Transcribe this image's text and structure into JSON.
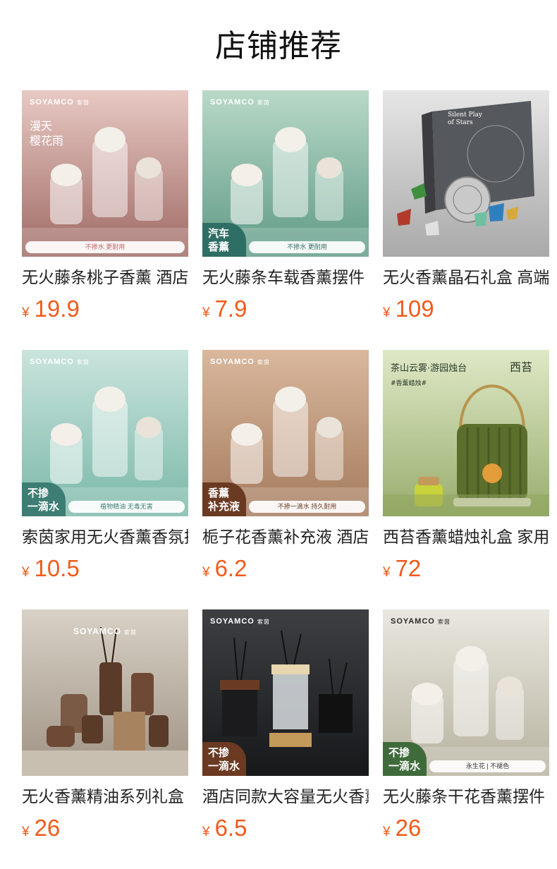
{
  "page": {
    "title": "店铺推荐"
  },
  "products": [
    {
      "name": "无火藤条桃子香薰 酒店同款",
      "currency": "¥",
      "price": "19.9",
      "image": {
        "bg": [
          "#e8c9c4",
          "#9f6a64"
        ],
        "brand_mark": "SOYAMCO",
        "brand_cn": "索茵",
        "overlay": "漫天\n樱花雨",
        "banner": "不掺水 更耐用",
        "banner_color": "#c06a6a"
      }
    },
    {
      "name": "无火藤条车载香薰摆件",
      "currency": "¥",
      "price": "7.9",
      "image": {
        "bg": [
          "#b9d9c8",
          "#5f9a86"
        ],
        "brand_mark": "SOYAMCO",
        "brand_cn": "索茵",
        "corner_badge": "汽车\n香薰",
        "corner_color": "#2f6e64",
        "banner": "不掺水 更耐用",
        "banner_color": "#2f6e64"
      }
    },
    {
      "name": "无火香薰晶石礼盒 高端礼物",
      "currency": "¥",
      "price": "109",
      "image": {
        "bg": [
          "#e6e6e6",
          "#a9a9a9"
        ],
        "box_text": "Silent Play\nof Stars"
      }
    },
    {
      "name": "索茵家用无火香薰香氛摆件",
      "currency": "¥",
      "price": "10.5",
      "image": {
        "bg": [
          "#c9e4dd",
          "#7bb8a8"
        ],
        "brand_mark": "SOYAMCO",
        "brand_cn": "索茵",
        "corner_badge": "不掺\n一滴水",
        "corner_color": "#3d7d73",
        "banner": "植物精油 无毒无害",
        "banner_color": "#3d7d73"
      }
    },
    {
      "name": "栀子花香薰补充液 酒店同款",
      "currency": "¥",
      "price": "6.2",
      "image": {
        "bg": [
          "#d9b89d",
          "#a47a5c"
        ],
        "brand_mark": "SOYAMCO",
        "brand_cn": "索茵",
        "corner_badge": "香薰\n补充液",
        "corner_color": "#6b3a22",
        "banner": "不掺一滴水 持久耐用",
        "banner_color": "#6b3a22"
      }
    },
    {
      "name": "西苔香薰蜡烛礼盒 家用",
      "currency": "¥",
      "price": "72",
      "image": {
        "bg": [
          "#dfe8c6",
          "#98ad6e"
        ],
        "overlay": "茶山云雾·游园烛台",
        "sub_overlay": "#香薰蜡烛#",
        "brand_text": "西苔"
      }
    },
    {
      "name": "无火香薰精油系列礼盒",
      "currency": "¥",
      "price": "26",
      "image": {
        "bg": [
          "#d8d1c6",
          "#9e9283"
        ],
        "brand_mark": "SOYAMCO",
        "brand_cn": "索茵"
      }
    },
    {
      "name": "酒店同款大容量无火香薰",
      "currency": "¥",
      "price": "6.5",
      "image": {
        "bg": [
          "#3d3f42",
          "#17181a"
        ],
        "brand_mark": "SOYAMCO",
        "brand_cn": "索茵",
        "corner_badge": "不掺\n一滴水",
        "corner_color": "#6b3a22"
      }
    },
    {
      "name": "无火藤条干花香薰摆件",
      "currency": "¥",
      "price": "26",
      "image": {
        "bg": [
          "#e9e7df",
          "#b7b29f"
        ],
        "brand_mark": "SOYAMCO",
        "brand_cn": "索茵",
        "corner_badge": "不掺\n一滴水",
        "corner_color": "#3f6b3a",
        "banner": "永生花 | 不褪色",
        "banner_color": "#333333"
      }
    }
  ]
}
